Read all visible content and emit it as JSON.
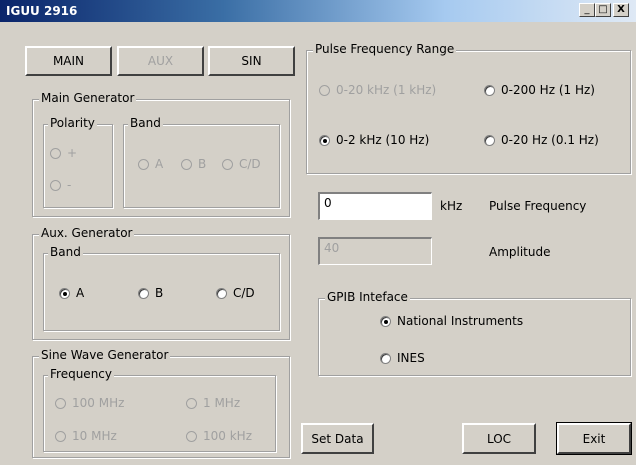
{
  "window": {
    "title": "IGUU 2916",
    "minimize": "_",
    "maximize": "□",
    "close": "X"
  },
  "tabs": {
    "main": "MAIN",
    "aux": "AUX",
    "sin": "SIN"
  },
  "main_generator": {
    "title": "Main Generator",
    "polarity": {
      "title": "Polarity",
      "plus": "+",
      "minus": "-"
    },
    "band": {
      "title": "Band",
      "a": "A",
      "b": "B",
      "cd": "C/D"
    }
  },
  "aux_generator": {
    "title": "Aux. Generator",
    "band": {
      "title": "Band",
      "a": "A",
      "b": "B",
      "cd": "C/D",
      "selected": "A"
    }
  },
  "sine_generator": {
    "title": "Sine Wave Generator",
    "frequency": {
      "title": "Frequency",
      "f100mhz": "100 MHz",
      "f1mhz": "1 MHz",
      "f10mhz": "10 MHz",
      "f100khz": "100 kHz"
    }
  },
  "pulse_range": {
    "title": "Pulse Frequency Range",
    "r20khz": "0-20 kHz (1 kHz)",
    "r200hz": "0-200 Hz (1 Hz)",
    "r2khz": "0-2 kHz (10 Hz)",
    "r20hz": "0-20 Hz (0.1 Hz)",
    "selected": "0-2 kHz (10 Hz)"
  },
  "pulse_frequency": {
    "value": "0",
    "unit": "kHz",
    "label": "Pulse Frequency"
  },
  "amplitude": {
    "value": "40",
    "label": "Amplitude"
  },
  "gpib": {
    "title": "GPIB Inteface",
    "ni": "National Instruments",
    "ines": "INES",
    "selected": "National Instruments"
  },
  "buttons": {
    "set_data": "Set Data",
    "loc": "LOC",
    "exit": "Exit"
  }
}
